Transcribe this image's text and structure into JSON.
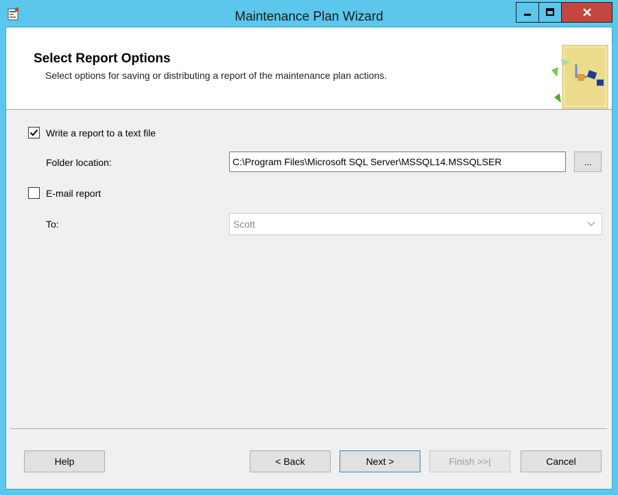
{
  "window": {
    "title": "Maintenance Plan Wizard",
    "titlebar_color": "#5cc7ec",
    "close_color": "#c4463f"
  },
  "header": {
    "title": "Select Report Options",
    "subtitle": "Select options for saving or distributing a report of the maintenance plan actions."
  },
  "report_text": {
    "label": "Write a report to a text file",
    "checked": true,
    "folder_label": "Folder location:",
    "folder_value": "C:\\Program Files\\Microsoft SQL Server\\MSSQL14.MSSQLSER",
    "browse_label": "..."
  },
  "email": {
    "label": "E-mail report",
    "checked": false,
    "to_label": "To:",
    "to_value": "Scott"
  },
  "buttons": {
    "help": "Help",
    "back": "< Back",
    "next": "Next >",
    "finish": "Finish >>|",
    "cancel": "Cancel"
  },
  "icons": {
    "app": "wizard-app-icon",
    "header": "maintenance-plan-graphic",
    "minimize": "minimize-icon",
    "maximize": "maximize-icon",
    "close": "close-icon"
  }
}
